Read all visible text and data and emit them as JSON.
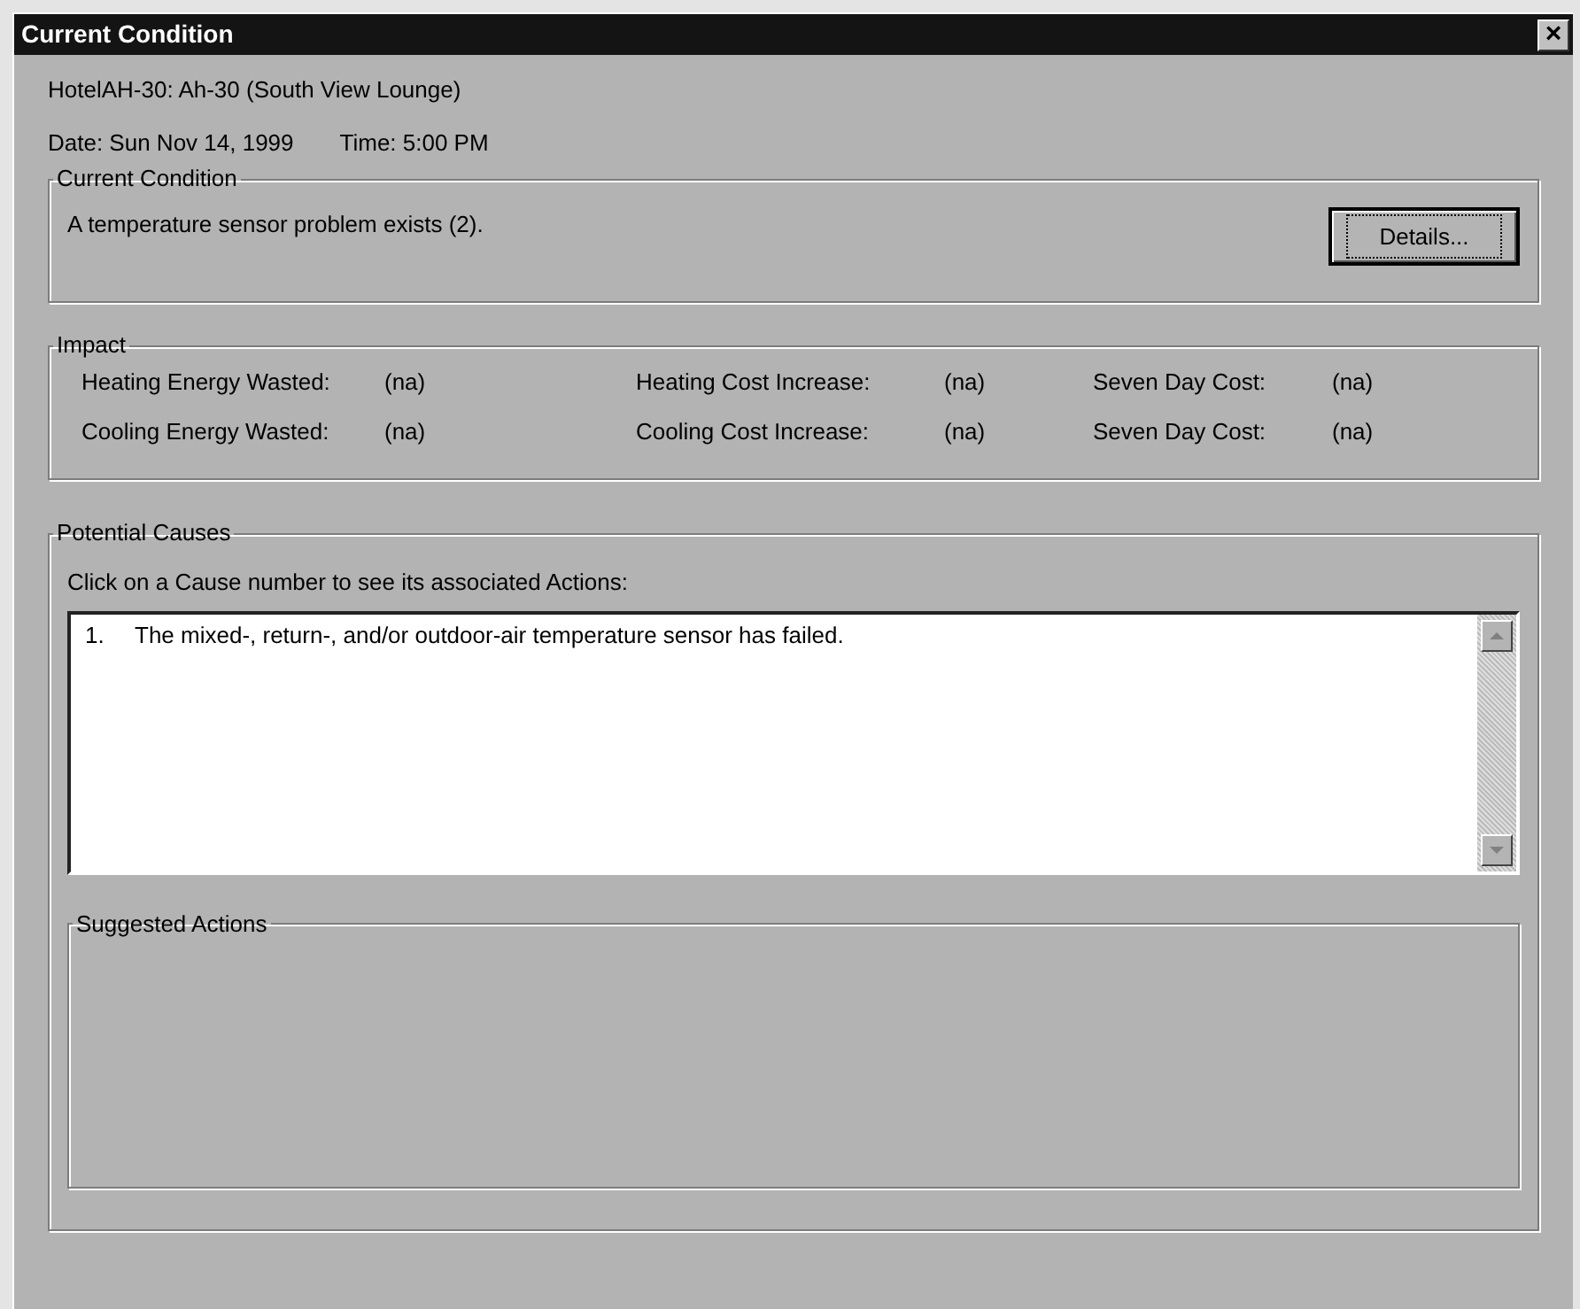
{
  "window": {
    "title": "Current Condition",
    "close": "×"
  },
  "location": "HotelAH-30: Ah-30 (South View Lounge)",
  "date": "Date: Sun Nov 14, 1999",
  "time": "Time: 5:00 PM",
  "current_condition": {
    "title": "Current Condition",
    "message": "A temperature sensor problem exists (2).",
    "button": "Details..."
  },
  "impact": {
    "title": "Impact",
    "rows": [
      [
        {
          "label": "Heating Energy Wasted:",
          "value": "(na)"
        },
        {
          "label": "Heating Cost Increase:",
          "value": "(na)"
        },
        {
          "label": "Seven Day Cost:",
          "value": "(na)"
        }
      ],
      [
        {
          "label": "Cooling Energy Wasted:",
          "value": "(na)"
        },
        {
          "label": "Cooling Cost Increase:",
          "value": "(na)"
        },
        {
          "label": "Seven Day Cost:",
          "value": "(na)"
        }
      ]
    ]
  },
  "potential_causes": {
    "title": "Potential Causes",
    "instruction": "Click on a Cause number to see its associated Actions:",
    "causes": [
      {
        "number": "1.",
        "text": "The mixed-, return-, and/or outdoor-air temperature sensor has failed.",
        "selected": false
      }
    ]
  },
  "suggested_actions": {
    "title": "Suggested Actions"
  }
}
